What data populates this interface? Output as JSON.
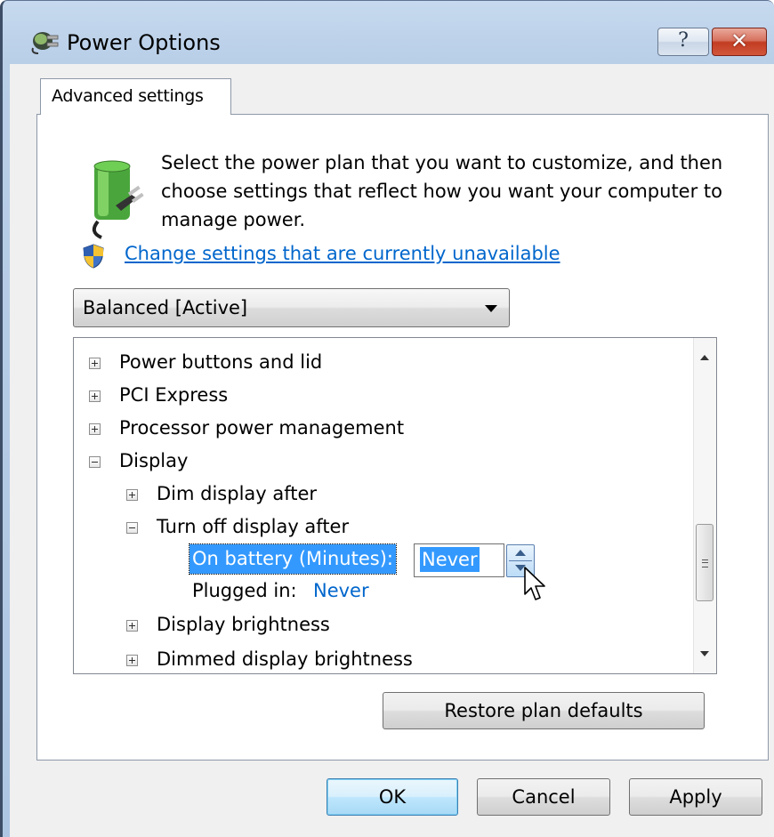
{
  "window": {
    "title": "Power Options",
    "help_label": "?",
    "close_label": "✕"
  },
  "tabs": [
    {
      "label": "Advanced settings"
    }
  ],
  "intro": {
    "text": "Select the power plan that you want to customize, and then choose settings that reflect how you want your computer to manage power."
  },
  "change_link": "Change settings that are currently unavailable",
  "plan_select": {
    "value": "Balanced [Active]"
  },
  "tree": {
    "items": [
      {
        "label": "Power buttons and lid",
        "expander": "plus"
      },
      {
        "label": "PCI Express",
        "expander": "plus"
      },
      {
        "label": "Processor power management",
        "expander": "plus"
      },
      {
        "label": "Display",
        "expander": "minus"
      },
      {
        "label": "Dim display after",
        "expander": "plus"
      },
      {
        "label": "Turn off display after",
        "expander": "minus"
      },
      {
        "label": "Display brightness",
        "expander": "plus"
      },
      {
        "label": "Dimmed display brightness",
        "expander": "plus"
      }
    ],
    "on_battery": {
      "label": "On battery (Minutes):",
      "value": "Never"
    },
    "plugged_in": {
      "label": "Plugged in:",
      "value": "Never"
    }
  },
  "buttons": {
    "restore": "Restore plan defaults",
    "ok": "OK",
    "cancel": "Cancel",
    "apply": "Apply"
  },
  "colors": {
    "link": "#0066cc",
    "selection": "#3399ff",
    "close_red": "#c23d22"
  },
  "icons": [
    "power-plug-icon",
    "battery-icon",
    "shield-icon",
    "plus-expander-icon",
    "minus-expander-icon",
    "spin-up-icon",
    "spin-down-icon",
    "mouse-cursor-icon",
    "scroll-up-icon",
    "scroll-down-icon"
  ]
}
